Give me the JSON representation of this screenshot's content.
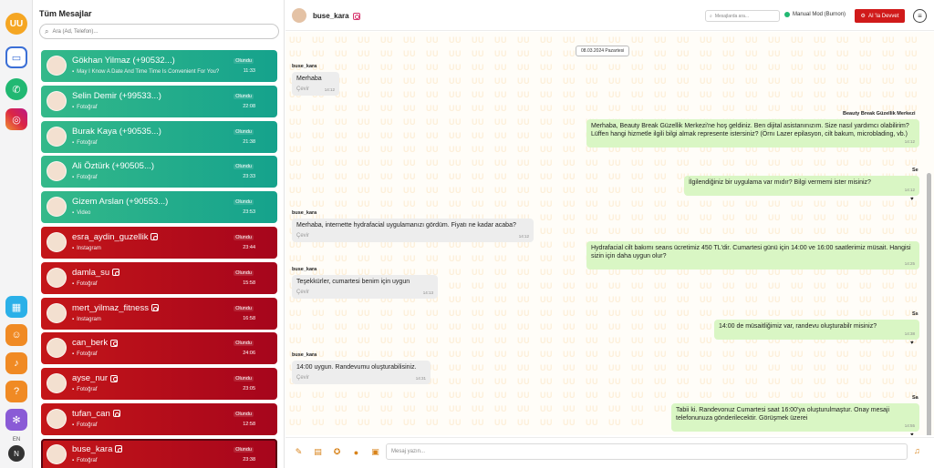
{
  "rail": {
    "logo_text": "UU",
    "language": "EN",
    "user_initial": "N",
    "items": [
      {
        "icon": "chat-icon"
      },
      {
        "icon": "whatsapp-icon"
      },
      {
        "icon": "instagram-icon"
      },
      {
        "icon": "calendar-icon"
      },
      {
        "icon": "users-icon"
      },
      {
        "icon": "bell-icon"
      },
      {
        "icon": "help-icon"
      },
      {
        "icon": "settings-icon"
      }
    ]
  },
  "list": {
    "title": "Tüm Mesajlar",
    "search_placeholder": "Ara (Ad, Telefon)...",
    "conversations": [
      {
        "name": "Gökhan Yilmaz (+90532...)",
        "preview": "May I Know A Date And Time Time Is Convenient For You?",
        "status": "Olundu",
        "time": "11:33",
        "channel": "whatsapp"
      },
      {
        "name": "Selin Demir (+99533...)",
        "preview": "Fotoğraf",
        "status": "Olundu",
        "time": "22:08",
        "channel": "whatsapp"
      },
      {
        "name": "Burak Kaya (+90535...)",
        "preview": "Fotoğraf",
        "status": "Olundu",
        "time": "21:38",
        "channel": "whatsapp"
      },
      {
        "name": "Ali Öztürk (+90505...)",
        "preview": "Fotoğraf",
        "status": "Olundu",
        "time": "23:33",
        "channel": "whatsapp"
      },
      {
        "name": "Gizem Arslan (+90553...)",
        "preview": "Video",
        "status": "Olundu",
        "time": "23:53",
        "channel": "whatsapp"
      },
      {
        "name": "esra_aydin_guzellik",
        "preview": "Instagram",
        "status": "Olundu",
        "time": "23:44",
        "channel": "instagram"
      },
      {
        "name": "damla_su",
        "preview": "Fotoğraf",
        "status": "Olundu",
        "time": "15:58",
        "channel": "instagram"
      },
      {
        "name": "mert_yilmaz_fitness",
        "preview": "Instagram",
        "status": "Olundu",
        "time": "16:58",
        "channel": "instagram"
      },
      {
        "name": "can_berk",
        "preview": "Fotoğraf",
        "status": "Olundu",
        "time": "24:06",
        "channel": "instagram"
      },
      {
        "name": "ayse_nur",
        "preview": "Fotoğraf",
        "status": "Olundu",
        "time": "23:05",
        "channel": "instagram"
      },
      {
        "name": "tufan_can",
        "preview": "Fotoğraf",
        "status": "Olundu",
        "time": "12:58",
        "channel": "instagram"
      },
      {
        "name": "buse_kara",
        "preview": "Fotoğraf",
        "status": "Olundu",
        "time": "23:38",
        "channel": "instagram",
        "active": true
      }
    ]
  },
  "header": {
    "contact_name": "buse_kara",
    "search_placeholder": "Mesajlarda ara...",
    "mode_label": "Manual Mod (Burnon)",
    "ai_button": "AI 'la Devvet"
  },
  "messages": {
    "date": "08.03.2024 Pazartesi",
    "business_name": "Beauty Break Güzellik Merkezi",
    "translate_label": "Çevir",
    "items": [
      {
        "dir": "in",
        "sender": "buse_kara",
        "text": "Merhaba",
        "time": "14:12"
      },
      {
        "dir": "out",
        "sender": "Beauty Break Güzellik Merkezi",
        "text": "Merhaba, Beauty Break Güzellik Merkezi'ne hoş geldiniz. Ben dijital asistanınızım. Size nasıl yardımcı olabilirim?\nLüffen hangi hizmetle ilgili bilgi almak represente istersiniz? (Örnı Lazer epilasyon, cilt bakum, microblading, vb.)",
        "time": "14:12"
      },
      {
        "dir": "out",
        "sender": "Se",
        "text": "İlgilendiğiniz bir uygulama var mıdır? Bilgi vermemi ister misiniz?",
        "time": "14:12"
      },
      {
        "dir": "in",
        "sender": "buse_kara",
        "text": "Merhaba, internette hydrafacial uygulamanızı gördüm. Fiyatı ne kadar acaba?",
        "time": "14:12"
      },
      {
        "dir": "out",
        "sender": "",
        "text": "Hydrafacial cilt bakımı seans ücretimiz 450 TL'dir. Cumartesi günü için 14:00 ve 16:00 saatlerimiz müsait. Hangisi sizin için daha uygun olur?",
        "time": "14:25"
      },
      {
        "dir": "in",
        "sender": "buse_kara",
        "text": "Teşekkürler, cumartesi benim için uygun",
        "time": "14:13"
      },
      {
        "dir": "out",
        "sender": "Ss",
        "text": "14:00 de müsaitliğimiz var, randevu oluşturabilr misiniz?",
        "time": "14:38"
      },
      {
        "dir": "in",
        "sender": "buse_kara",
        "text": "14:00 uygun. Randevumu oluşturabilisiniz.",
        "time": "14:31"
      },
      {
        "dir": "out",
        "sender": "Sa",
        "text": "Tabii ki. Randevonuz Cumartesi saat 16:00'ya oluşturulmaştur. Onay mesaji telefonunuza gönderilecektir. Görüşmek üzerei",
        "time": "14:55"
      }
    ]
  },
  "composer": {
    "placeholder": "Mesaj yazın..."
  },
  "colors": {
    "whatsapp_green": "#15a28c",
    "instagram_red": "#c41619",
    "accent_blue": "#3b6fd6",
    "accent_orange": "#f5a623",
    "ai_button_red": "#d01a1a",
    "bubble_out": "#d9f6c4",
    "bubble_in": "#ededed"
  }
}
